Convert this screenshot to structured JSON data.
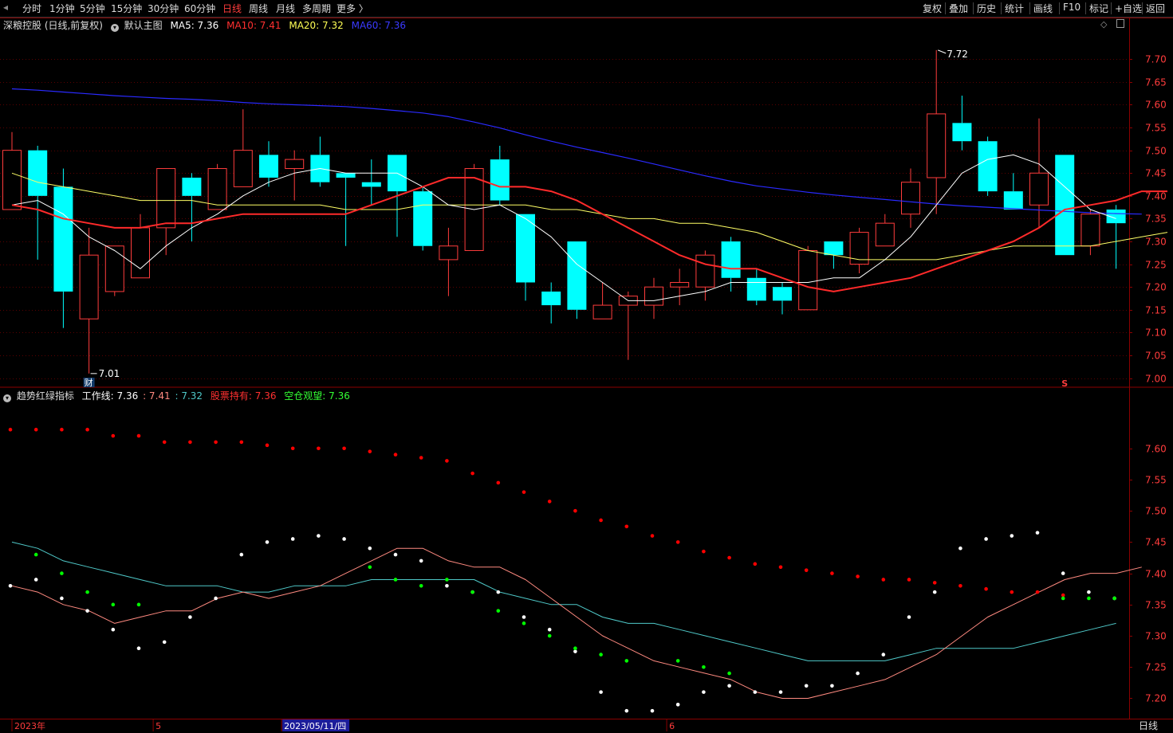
{
  "toolbar": {
    "left_items": [
      "分时",
      "1分钟",
      "5分钟",
      "15分钟",
      "30分钟",
      "60分钟",
      "日线",
      "周线",
      "月线",
      "多周期",
      "更多 〉"
    ],
    "active": "日线",
    "right_items": [
      "复权",
      "叠加",
      "历史",
      "统计",
      "画线",
      "F10",
      "标记",
      "+自选",
      "返回"
    ]
  },
  "main_legend": {
    "stock": "深粮控股 (日线,前复权)",
    "template": "默认主图",
    "ma5": "MA5: 7.36",
    "ma10": "MA10: 7.41",
    "ma20": "MA20: 7.32",
    "ma60": "MA60: 7.36"
  },
  "sub_legend": {
    "title": "趋势红绿指标",
    "work_line": "工作线: 7.36",
    "v2": ": 7.41",
    "v3": ": 7.32",
    "hold": "股票持有: 7.36",
    "watch": "空仓观望: 7.36"
  },
  "annotations": {
    "high": "7.72",
    "low": "7.01",
    "cai": "财",
    "s_marker": "S"
  },
  "date_axis": {
    "labels": [
      {
        "text": "2023年",
        "index": 0
      },
      {
        "text": "5",
        "index": 6
      },
      {
        "text": "2023/05/11/四",
        "index": 11,
        "highlight": true
      },
      {
        "text": "6",
        "index": 26
      }
    ]
  },
  "period_label": "日线",
  "colors": {
    "up": "#ff3c3c",
    "down": "#00ffff",
    "ma5": "#ffffff",
    "ma10": "#ff2a2a",
    "ma20": "#ffff66",
    "ma60": "#2a2aff",
    "dot_red": "#ff0000",
    "dot_white": "#ffffff",
    "dot_green": "#00ff00",
    "salmon": "#ff8a80",
    "teal": "#4fc9c9"
  },
  "chart_data": {
    "type": "candlestick",
    "main": {
      "ylim": [
        6.98,
        7.76
      ],
      "ticks": [
        "7.70",
        "7.65",
        "7.60",
        "7.55",
        "7.50",
        "7.45",
        "7.40",
        "7.35",
        "7.30",
        "7.25",
        "7.20",
        "7.15",
        "7.10",
        "7.05",
        "7.00"
      ],
      "candles": [
        {
          "o": 7.37,
          "c": 7.5,
          "h": 7.54,
          "l": 7.37
        },
        {
          "o": 7.5,
          "c": 7.4,
          "h": 7.51,
          "l": 7.26
        },
        {
          "o": 7.42,
          "c": 7.19,
          "h": 7.46,
          "l": 7.11
        },
        {
          "o": 7.13,
          "c": 7.27,
          "h": 7.33,
          "l": 7.01
        },
        {
          "o": 7.19,
          "c": 7.29,
          "h": 7.29,
          "l": 7.18
        },
        {
          "o": 7.22,
          "c": 7.33,
          "h": 7.36,
          "l": 7.22
        },
        {
          "o": 7.33,
          "c": 7.46,
          "h": 7.46,
          "l": 7.27
        },
        {
          "o": 7.44,
          "c": 7.4,
          "h": 7.45,
          "l": 7.3
        },
        {
          "o": 7.37,
          "c": 7.46,
          "h": 7.47,
          "l": 7.37
        },
        {
          "o": 7.42,
          "c": 7.5,
          "h": 7.59,
          "l": 7.42
        },
        {
          "o": 7.49,
          "c": 7.44,
          "h": 7.52,
          "l": 7.42
        },
        {
          "o": 7.46,
          "c": 7.48,
          "h": 7.5,
          "l": 7.39
        },
        {
          "o": 7.49,
          "c": 7.43,
          "h": 7.53,
          "l": 7.42
        },
        {
          "o": 7.45,
          "c": 7.44,
          "h": 7.45,
          "l": 7.29
        },
        {
          "o": 7.43,
          "c": 7.42,
          "h": 7.48,
          "l": 7.38
        },
        {
          "o": 7.49,
          "c": 7.41,
          "h": 7.49,
          "l": 7.31
        },
        {
          "o": 7.41,
          "c": 7.29,
          "h": 7.42,
          "l": 7.28
        },
        {
          "o": 7.26,
          "c": 7.29,
          "h": 7.33,
          "l": 7.18
        },
        {
          "o": 7.28,
          "c": 7.46,
          "h": 7.47,
          "l": 7.28
        },
        {
          "o": 7.48,
          "c": 7.39,
          "h": 7.51,
          "l": 7.38
        },
        {
          "o": 7.36,
          "c": 7.21,
          "h": 7.36,
          "l": 7.17
        },
        {
          "o": 7.19,
          "c": 7.16,
          "h": 7.21,
          "l": 7.12
        },
        {
          "o": 7.3,
          "c": 7.15,
          "h": 7.3,
          "l": 7.13
        },
        {
          "o": 7.13,
          "c": 7.16,
          "h": 7.21,
          "l": 7.13
        },
        {
          "o": 7.16,
          "c": 7.18,
          "h": 7.19,
          "l": 7.04
        },
        {
          "o": 7.16,
          "c": 7.2,
          "h": 7.22,
          "l": 7.13
        },
        {
          "o": 7.2,
          "c": 7.21,
          "h": 7.24,
          "l": 7.16
        },
        {
          "o": 7.2,
          "c": 7.27,
          "h": 7.28,
          "l": 7.17
        },
        {
          "o": 7.3,
          "c": 7.22,
          "h": 7.31,
          "l": 7.19
        },
        {
          "o": 7.22,
          "c": 7.17,
          "h": 7.24,
          "l": 7.16
        },
        {
          "o": 7.2,
          "c": 7.17,
          "h": 7.21,
          "l": 7.14
        },
        {
          "o": 7.15,
          "c": 7.28,
          "h": 7.29,
          "l": 7.15
        },
        {
          "o": 7.3,
          "c": 7.27,
          "h": 7.3,
          "l": 7.24
        },
        {
          "o": 7.25,
          "c": 7.32,
          "h": 7.33,
          "l": 7.23
        },
        {
          "o": 7.29,
          "c": 7.34,
          "h": 7.36,
          "l": 7.29
        },
        {
          "o": 7.36,
          "c": 7.43,
          "h": 7.46,
          "l": 7.33
        },
        {
          "o": 7.44,
          "c": 7.58,
          "h": 7.72,
          "l": 7.36
        },
        {
          "o": 7.56,
          "c": 7.52,
          "h": 7.62,
          "l": 7.5
        },
        {
          "o": 7.52,
          "c": 7.41,
          "h": 7.53,
          "l": 7.4
        },
        {
          "o": 7.41,
          "c": 7.37,
          "h": 7.45,
          "l": 7.37
        },
        {
          "o": 7.38,
          "c": 7.45,
          "h": 7.57,
          "l": 7.33
        },
        {
          "o": 7.49,
          "c": 7.27,
          "h": 7.49,
          "l": 7.27
        },
        {
          "o": 7.29,
          "c": 7.36,
          "h": 7.37,
          "l": 7.27
        },
        {
          "o": 7.37,
          "c": 7.34,
          "h": 7.38,
          "l": 7.24
        }
      ],
      "ma5": [
        7.38,
        7.39,
        7.36,
        7.31,
        7.28,
        7.24,
        7.29,
        7.33,
        7.36,
        7.4,
        7.43,
        7.45,
        7.46,
        7.45,
        7.45,
        7.45,
        7.42,
        7.38,
        7.37,
        7.38,
        7.35,
        7.31,
        7.25,
        7.21,
        7.17,
        7.17,
        7.18,
        7.19,
        7.21,
        7.21,
        7.21,
        7.21,
        7.22,
        7.22,
        7.26,
        7.31,
        7.38,
        7.45,
        7.48,
        7.49,
        7.47,
        7.42,
        7.37,
        7.35
      ],
      "ma10": [
        7.38,
        7.37,
        7.35,
        7.34,
        7.33,
        7.33,
        7.34,
        7.34,
        7.35,
        7.36,
        7.36,
        7.36,
        7.36,
        7.36,
        7.38,
        7.4,
        7.42,
        7.44,
        7.44,
        7.42,
        7.42,
        7.41,
        7.39,
        7.36,
        7.33,
        7.3,
        7.27,
        7.25,
        7.24,
        7.24,
        7.22,
        7.2,
        7.19,
        7.2,
        7.21,
        7.22,
        7.24,
        7.26,
        7.28,
        7.3,
        7.33,
        7.37,
        7.38,
        7.39,
        7.41,
        7.41
      ],
      "ma20": [
        7.45,
        7.43,
        7.42,
        7.41,
        7.4,
        7.39,
        7.39,
        7.39,
        7.38,
        7.38,
        7.38,
        7.38,
        7.38,
        7.37,
        7.37,
        7.37,
        7.38,
        7.38,
        7.38,
        7.38,
        7.38,
        7.37,
        7.37,
        7.36,
        7.35,
        7.35,
        7.34,
        7.34,
        7.33,
        7.32,
        7.3,
        7.28,
        7.27,
        7.26,
        7.26,
        7.26,
        7.26,
        7.27,
        7.28,
        7.29,
        7.29,
        7.29,
        7.29,
        7.3,
        7.31,
        7.32
      ],
      "ma60": [
        7.635,
        7.632,
        7.628,
        7.624,
        7.62,
        7.617,
        7.614,
        7.612,
        7.609,
        7.605,
        7.602,
        7.6,
        7.598,
        7.596,
        7.592,
        7.587,
        7.582,
        7.574,
        7.562,
        7.549,
        7.534,
        7.52,
        7.507,
        7.495,
        7.483,
        7.47,
        7.457,
        7.444,
        7.432,
        7.422,
        7.415,
        7.408,
        7.402,
        7.397,
        7.392,
        7.387,
        7.382,
        7.378,
        7.375,
        7.372,
        7.369,
        7.366,
        7.363,
        7.361,
        7.36
      ]
    },
    "sub": {
      "ylim": [
        7.17,
        7.68
      ],
      "ticks": [
        "7.60",
        "7.55",
        "7.50",
        "7.45",
        "7.40",
        "7.35",
        "7.30",
        "7.25",
        "7.20"
      ],
      "red_dots": [
        7.63,
        7.63,
        7.63,
        7.63,
        7.62,
        7.62,
        7.61,
        7.61,
        7.61,
        7.61,
        7.605,
        7.6,
        7.6,
        7.6,
        7.595,
        7.59,
        7.585,
        7.58,
        7.56,
        7.545,
        7.53,
        7.515,
        7.5,
        7.485,
        7.475,
        7.46,
        7.45,
        7.435,
        7.425,
        7.415,
        7.41,
        7.405,
        7.4,
        7.395,
        7.39,
        7.39,
        7.385,
        7.38,
        7.375,
        7.37,
        7.37,
        7.365
      ],
      "white_dots": [
        7.38,
        7.39,
        7.36,
        7.34,
        7.31,
        7.28,
        7.29,
        7.33,
        7.36,
        7.43,
        7.45,
        7.455,
        7.46,
        7.455,
        7.44,
        7.43,
        7.42,
        7.38,
        7.37,
        7.37,
        7.33,
        7.31,
        7.275,
        7.21,
        7.18,
        7.18,
        7.19,
        7.21,
        7.22,
        7.21,
        7.21,
        7.22,
        7.22,
        7.24,
        7.27,
        7.33,
        7.37,
        7.44,
        7.455,
        7.46,
        7.465,
        7.4,
        7.37,
        7.36
      ],
      "green_dots": [
        null,
        7.43,
        7.4,
        7.37,
        7.35,
        7.35,
        null,
        null,
        null,
        null,
        null,
        null,
        null,
        null,
        7.41,
        7.39,
        7.38,
        7.39,
        7.37,
        7.34,
        7.32,
        7.3,
        7.28,
        7.27,
        7.26,
        null,
        7.26,
        7.25,
        7.24,
        null,
        null,
        null,
        null,
        null,
        null,
        null,
        null,
        null,
        null,
        null,
        null,
        7.36,
        7.36,
        7.36
      ],
      "salmon_line": [
        7.38,
        7.37,
        7.35,
        7.34,
        7.32,
        7.33,
        7.34,
        7.34,
        7.36,
        7.37,
        7.36,
        7.37,
        7.38,
        7.4,
        7.42,
        7.44,
        7.44,
        7.42,
        7.41,
        7.41,
        7.39,
        7.36,
        7.33,
        7.3,
        7.28,
        7.26,
        7.25,
        7.24,
        7.23,
        7.21,
        7.2,
        7.2,
        7.21,
        7.22,
        7.23,
        7.25,
        7.27,
        7.3,
        7.33,
        7.35,
        7.37,
        7.39,
        7.4,
        7.4,
        7.41
      ],
      "teal_line": [
        7.45,
        7.44,
        7.42,
        7.41,
        7.4,
        7.39,
        7.38,
        7.38,
        7.38,
        7.37,
        7.37,
        7.38,
        7.38,
        7.38,
        7.39,
        7.39,
        7.39,
        7.39,
        7.39,
        7.37,
        7.36,
        7.35,
        7.35,
        7.33,
        7.32,
        7.32,
        7.31,
        7.3,
        7.29,
        7.28,
        7.27,
        7.26,
        7.26,
        7.26,
        7.26,
        7.27,
        7.28,
        7.28,
        7.28,
        7.28,
        7.29,
        7.3,
        7.31,
        7.32
      ]
    }
  }
}
